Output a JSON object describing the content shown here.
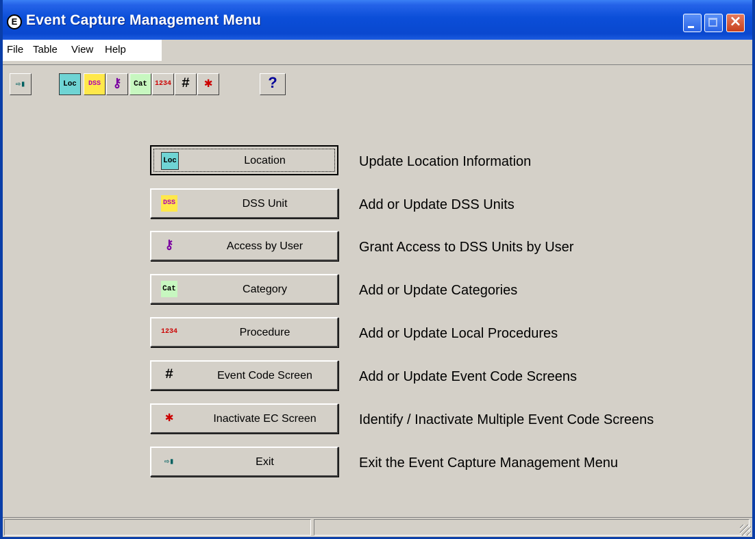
{
  "window": {
    "title": "Event Capture Management Menu",
    "app_icon": "E",
    "title_bar_color": "#0a48cf",
    "close_button_color": "#c7401c"
  },
  "menu": [
    {
      "label": "File"
    },
    {
      "label": "Table"
    },
    {
      "label": "View"
    },
    {
      "label": "Help"
    }
  ],
  "toolbar": [
    {
      "name": "exit-tool-button",
      "icon": "exit-door-icon",
      "glyph": "⇨▮"
    },
    {
      "name": "location-tool-button",
      "icon": "location-icon",
      "glyph": "Loc"
    },
    {
      "name": "dss-unit-tool-button",
      "icon": "dss-unit-icon",
      "glyph": "DSS"
    },
    {
      "name": "access-tool-button",
      "icon": "access-keys-icon",
      "glyph": "⚷"
    },
    {
      "name": "category-tool-button",
      "icon": "category-icon",
      "glyph": "Cat"
    },
    {
      "name": "procedure-tool-button",
      "icon": "procedure-icon",
      "glyph": "1234"
    },
    {
      "name": "event-code-screen-tool-button",
      "icon": "grid-icon",
      "glyph": "#"
    },
    {
      "name": "inactivate-tool-button",
      "icon": "grid-inactive-icon",
      "glyph": "✱"
    },
    {
      "name": "help-tool-button",
      "icon": "help-question-icon",
      "glyph": "?"
    }
  ],
  "buttons": [
    {
      "label": "Location",
      "icon": "location-icon",
      "glyph": "Loc",
      "description": "Update Location Information",
      "focused": true
    },
    {
      "label": "DSS Unit",
      "icon": "dss-unit-icon",
      "glyph": "DSS",
      "description": "Add or Update DSS Units"
    },
    {
      "label": "Access by User",
      "icon": "access-keys-icon",
      "glyph": "⚷",
      "description": "Grant Access to DSS Units by User"
    },
    {
      "label": "Category",
      "icon": "category-icon",
      "glyph": "Cat",
      "description": "Add or Update Categories"
    },
    {
      "label": "Procedure",
      "icon": "procedure-icon",
      "glyph": "1234",
      "description": "Add or Update Local Procedures"
    },
    {
      "label": "Event Code Screen",
      "icon": "grid-icon",
      "glyph": "#",
      "description": "Add or Update Event Code Screens"
    },
    {
      "label": "Inactivate EC Screen",
      "icon": "grid-inactive-icon",
      "glyph": "✱",
      "description": "Identify / Inactivate Multiple Event Code Screens"
    },
    {
      "label": "Exit",
      "icon": "exit-door-icon",
      "glyph": "⇨▮",
      "description": "Exit the Event Capture Management Menu"
    }
  ],
  "status": {
    "pane1": "",
    "pane2": ""
  }
}
